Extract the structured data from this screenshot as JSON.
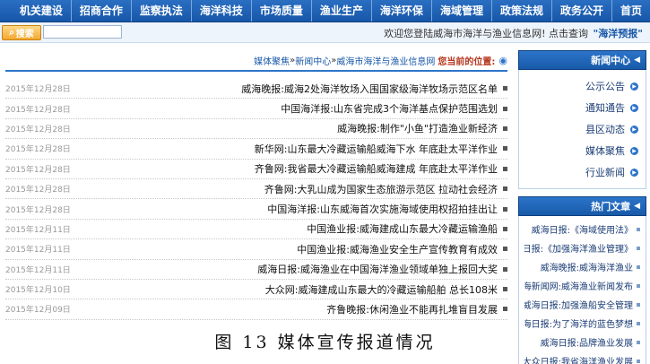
{
  "nav": {
    "items": [
      "首页",
      "政务公开",
      "政策法规",
      "海域管理",
      "海洋环保",
      "渔业生产",
      "市场质量",
      "海洋科技",
      "监察执法",
      "招商合作",
      "机关建设"
    ]
  },
  "topbar": {
    "welcome_prefix": "欢迎您登陆威海市海洋与渔业信息网!",
    "welcome_mid": "点击查询",
    "welcome_highlight": "\"海洋预报\"",
    "search_label": "搜索",
    "search_placeholder": ""
  },
  "breadcrumb": {
    "label": "您当前的位置:",
    "parts": [
      "威海市海洋与渔业信息网",
      "新闻中心",
      "媒体聚焦"
    ],
    "separator": "»"
  },
  "news": [
    {
      "title": "威海晚报:威海2处海洋牧场入围国家级海洋牧场示范区名单",
      "date": "2015年12月28日"
    },
    {
      "title": "中国海洋报:山东省完成3个海洋基点保护范围选划",
      "date": "2015年12月28日"
    },
    {
      "title": "威海晚报:制作\"小鱼\"打造渔业新经济",
      "date": "2015年12月28日"
    },
    {
      "title": "新华网:山东最大冷藏运输船威海下水 年底赴太平洋作业",
      "date": "2015年12月28日"
    },
    {
      "title": "齐鲁网:我省最大冷藏运输船威海建成 年底赴太平洋作业",
      "date": "2015年12月28日"
    },
    {
      "title": "齐鲁网:大乳山成为国家生态旅游示范区 拉动社会经济",
      "date": "2015年12月28日"
    },
    {
      "title": "中国海洋报:山东威海首次实施海域使用权招拍挂出让",
      "date": "2015年12月28日"
    },
    {
      "title": "中国渔业报:威海建成山东最大冷藏运输渔船",
      "date": "2015年12月11日"
    },
    {
      "title": "中国渔业报:威海渔业安全生产宣传教育有成效",
      "date": "2015年12月11日"
    },
    {
      "title": "威海日报:威海渔业在中国海洋渔业领域单独上报回大奖",
      "date": "2015年12月11日"
    },
    {
      "title": "大众网:威海建成山东最大的冷藏运输船舶 总长108米",
      "date": "2015年12月10日"
    },
    {
      "title": "齐鲁晚报:休闲渔业不能再扎堆盲目发展",
      "date": "2015年12月09日"
    }
  ],
  "sidebar": {
    "news_center_title": "新闻中心",
    "links": [
      "公示公告",
      "通知通告",
      "县区动态",
      "媒体聚焦",
      "行业新闻"
    ],
    "hot_title": "热门文章",
    "hot": [
      "威海日报:《海域使用法》",
      "威海日报:《加强海洋渔业管理》",
      "威海晚报:威海海洋渔业",
      "威海新闻网:威海渔业新闻发布",
      "威海日报:加强渔船安全管理",
      "威海日报:为了海洋的蓝色梦想",
      "威海日报:品牌渔业发展",
      "大众日报:我省海洋渔业发展"
    ]
  },
  "caption": "图 13 媒体宣传报道情况"
}
